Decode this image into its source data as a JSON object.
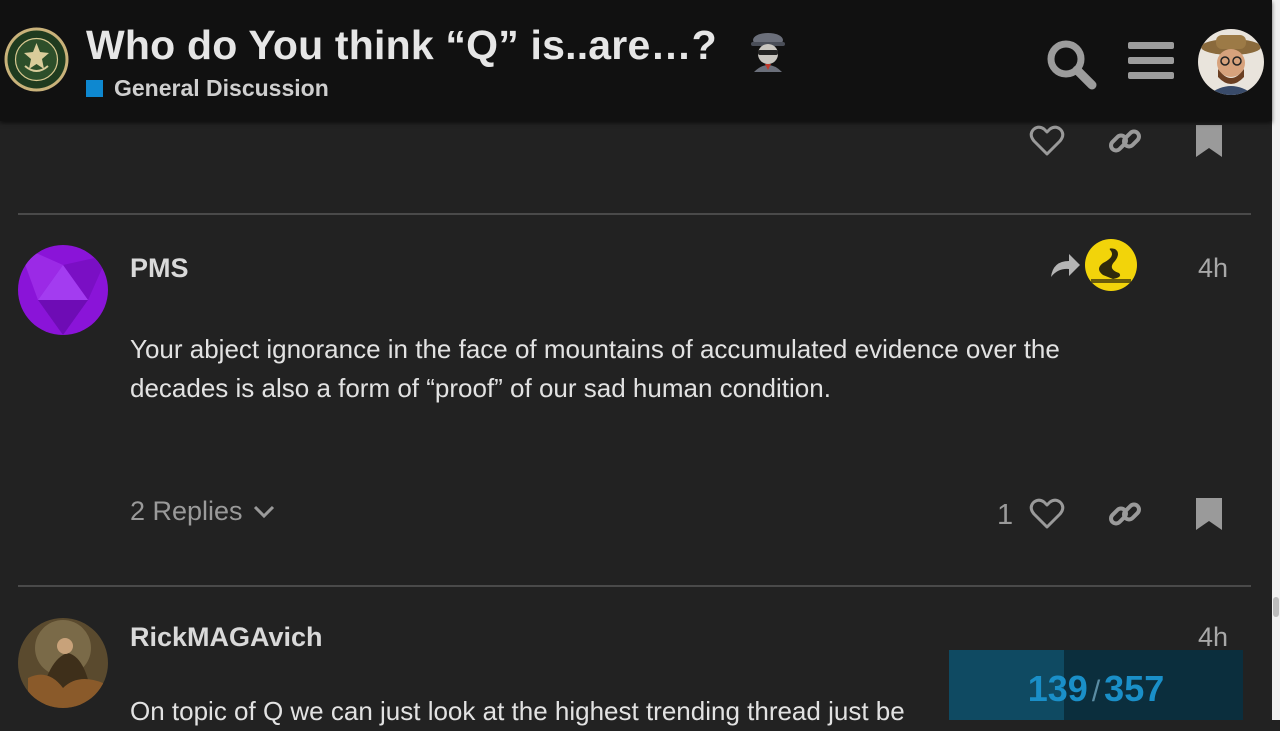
{
  "header": {
    "title": "Who do You think “Q” is..are…?",
    "category": {
      "label": "General Discussion",
      "color": "#0e88d0"
    },
    "logo_icon": "army-seal-logo",
    "title_emoji": "detective-emoji",
    "search_icon": "search-icon",
    "menu_icon": "hamburger-icon",
    "avatar_icon": "user-avatar"
  },
  "posts": [
    {
      "username": "PMS",
      "date": "4h",
      "body": "Your abject ignorance in the face of mountains of accumulated evidence over the decades is also a form of “proof” of our sad human condition.",
      "replies_label": "2 Replies",
      "like_count": "1",
      "avatar_color": "#8a14d8"
    },
    {
      "username": "RickMAGAvich",
      "date": "4h",
      "body": "On topic of Q we can just look at the highest trending thread just be"
    }
  ],
  "progress": {
    "current": "139",
    "separator": "/",
    "total": "357",
    "fraction": 0.39
  },
  "colors": {
    "background": "#222222",
    "header": "#111111",
    "accent": "#1a8fc8"
  }
}
